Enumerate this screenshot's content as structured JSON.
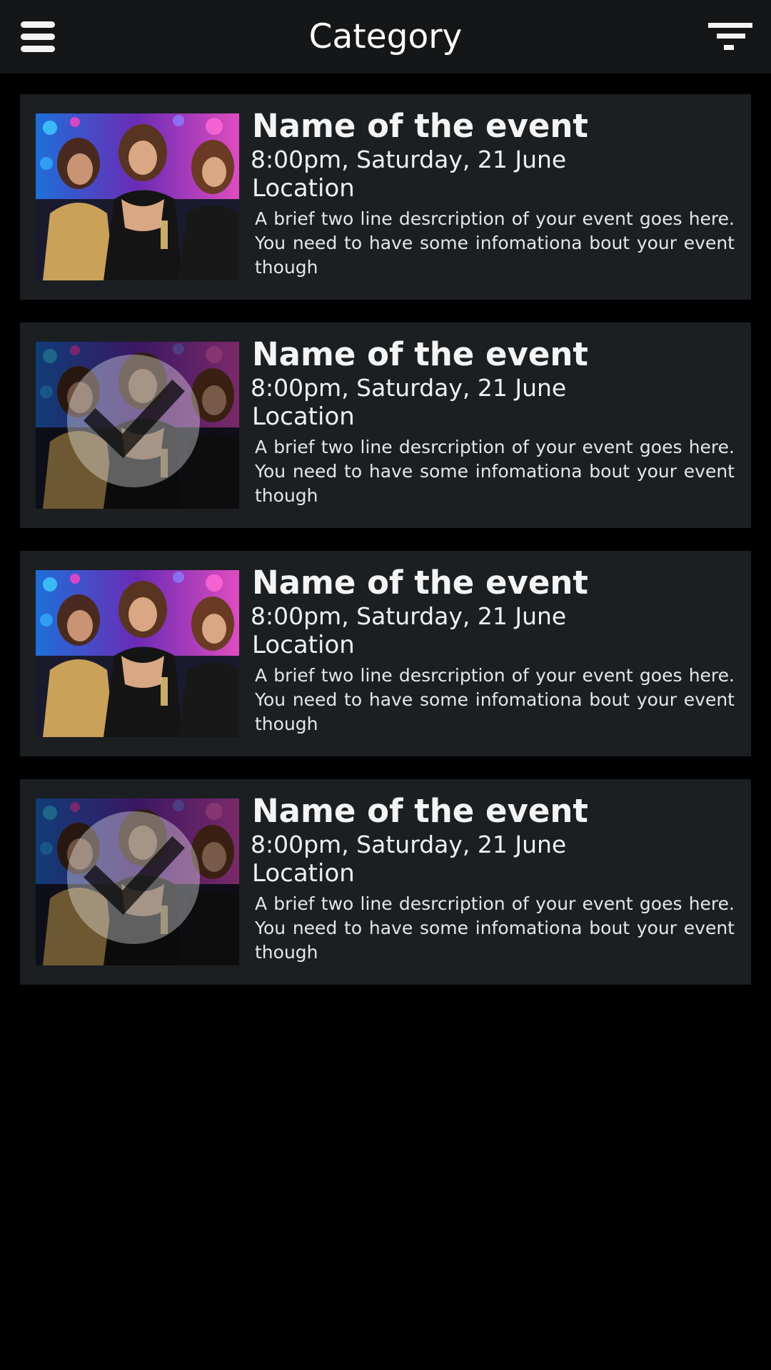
{
  "header": {
    "title": "Category",
    "menu_icon": "hamburger-menu-icon",
    "filter_icon": "filter-icon"
  },
  "colors": {
    "background": "#000000",
    "header": "#151617",
    "card": "#1b1f22",
    "text": "#f2f2f2"
  },
  "events": [
    {
      "name": "Name of the event",
      "time": "8:00pm, Saturday, 21 June",
      "location": "Location",
      "description": "A brief two line desrcription of your event goes here. You need to have some infomationa bout your event though",
      "selected": false
    },
    {
      "name": "Name of the event",
      "time": "8:00pm, Saturday, 21 June",
      "location": "Location",
      "description": "A brief two line desrcription of your event goes here. You need to have some infomationa bout your event though",
      "selected": true
    },
    {
      "name": "Name of the event",
      "time": "8:00pm, Saturday, 21 June",
      "location": "Location",
      "description": "A brief two line desrcription of your event goes here. You need to have some infomationa bout your event though",
      "selected": false
    },
    {
      "name": "Name of the event",
      "time": "8:00pm, Saturday, 21 June",
      "location": "Location",
      "description": "A brief two line desrcription of your event goes here. You need to have some infomationa bout your event though",
      "selected": true
    }
  ]
}
